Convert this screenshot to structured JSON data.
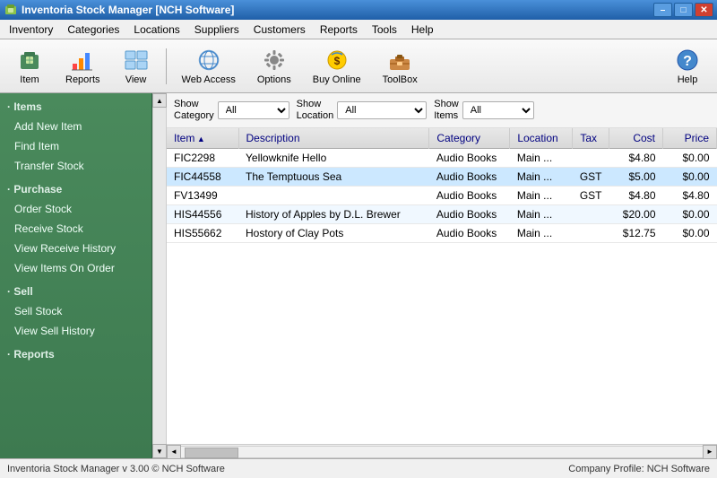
{
  "titleBar": {
    "title": "Inventoria Stock Manager [NCH Software]",
    "icon": "📦",
    "minimizeLabel": "–",
    "maximizeLabel": "□",
    "closeLabel": "✕"
  },
  "menuBar": {
    "items": [
      {
        "id": "inventory",
        "label": "Inventory"
      },
      {
        "id": "categories",
        "label": "Categories"
      },
      {
        "id": "locations",
        "label": "Locations"
      },
      {
        "id": "suppliers",
        "label": "Suppliers"
      },
      {
        "id": "customers",
        "label": "Customers"
      },
      {
        "id": "reports",
        "label": "Reports"
      },
      {
        "id": "tools",
        "label": "Tools"
      },
      {
        "id": "help",
        "label": "Help"
      }
    ]
  },
  "toolbar": {
    "buttons": [
      {
        "id": "item",
        "label": "Item",
        "icon": "item"
      },
      {
        "id": "reports",
        "label": "Reports",
        "icon": "reports"
      },
      {
        "id": "view",
        "label": "View",
        "icon": "view"
      },
      {
        "id": "webaccess",
        "label": "Web Access",
        "icon": "webaccess"
      },
      {
        "id": "options",
        "label": "Options",
        "icon": "options"
      },
      {
        "id": "buyonline",
        "label": "Buy Online",
        "icon": "buyonline"
      },
      {
        "id": "toolbox",
        "label": "ToolBox",
        "icon": "toolbox"
      },
      {
        "id": "help",
        "label": "Help",
        "icon": "help"
      }
    ]
  },
  "filterBar": {
    "showCategoryLabel": "Show\nCategory",
    "showLocationLabel": "Show\nLocation",
    "showItemsLabel": "Show\nItems",
    "categoryOptions": [
      "All"
    ],
    "locationOptions": [
      "All"
    ],
    "itemsOptions": [
      "All"
    ],
    "categoryValue": "All",
    "locationValue": "All",
    "itemsValue": "All"
  },
  "sidebar": {
    "sections": [
      {
        "id": "items",
        "header": "· Items",
        "items": [
          {
            "id": "add-new-item",
            "label": "Add New Item"
          },
          {
            "id": "find-item",
            "label": "Find Item"
          },
          {
            "id": "transfer-stock",
            "label": "Transfer Stock"
          }
        ]
      },
      {
        "id": "purchase",
        "header": "· Purchase",
        "items": [
          {
            "id": "order-stock",
            "label": "Order Stock"
          },
          {
            "id": "receive-stock",
            "label": "Receive Stock"
          },
          {
            "id": "view-receive-history",
            "label": "View Receive History"
          },
          {
            "id": "view-items-on-order",
            "label": "View Items On Order"
          }
        ]
      },
      {
        "id": "sell",
        "header": "· Sell",
        "items": [
          {
            "id": "sell-stock",
            "label": "Sell Stock"
          },
          {
            "id": "view-sell-history",
            "label": "View Sell History"
          }
        ]
      },
      {
        "id": "reports",
        "header": "· Reports",
        "items": []
      }
    ]
  },
  "table": {
    "columns": [
      {
        "id": "item",
        "label": "Item",
        "sortActive": true
      },
      {
        "id": "description",
        "label": "Description"
      },
      {
        "id": "category",
        "label": "Category"
      },
      {
        "id": "location",
        "label": "Location"
      },
      {
        "id": "tax",
        "label": "Tax"
      },
      {
        "id": "cost",
        "label": "Cost"
      },
      {
        "id": "price",
        "label": "Price"
      }
    ],
    "rows": [
      {
        "item": "FIC2298",
        "description": "Yellowknife Hello",
        "category": "Audio Books",
        "location": "Main ...",
        "tax": "",
        "cost": "$4.80",
        "price": "$0.00",
        "highlight": false
      },
      {
        "item": "FIC44558",
        "description": "The Temptuous Sea",
        "category": "Audio Books",
        "location": "Main ...",
        "tax": "GST",
        "cost": "$5.00",
        "price": "$0.00",
        "highlight": true
      },
      {
        "item": "FV13499",
        "description": "",
        "category": "Audio Books",
        "location": "Main ...",
        "tax": "GST",
        "cost": "$4.80",
        "price": "$4.80",
        "highlight": false
      },
      {
        "item": "HIS44556",
        "description": "History of Apples by D.L. Brewer",
        "category": "Audio Books",
        "location": "Main ...",
        "tax": "",
        "cost": "$20.00",
        "price": "$0.00",
        "highlight": false
      },
      {
        "item": "HIS55662",
        "description": "Hostory of Clay Pots",
        "category": "Audio Books",
        "location": "Main ...",
        "tax": "",
        "cost": "$12.75",
        "price": "$0.00",
        "highlight": false
      }
    ]
  },
  "statusBar": {
    "left": "Inventoria Stock Manager v 3.00 © NCH Software",
    "right": "Company Profile: NCH Software"
  }
}
